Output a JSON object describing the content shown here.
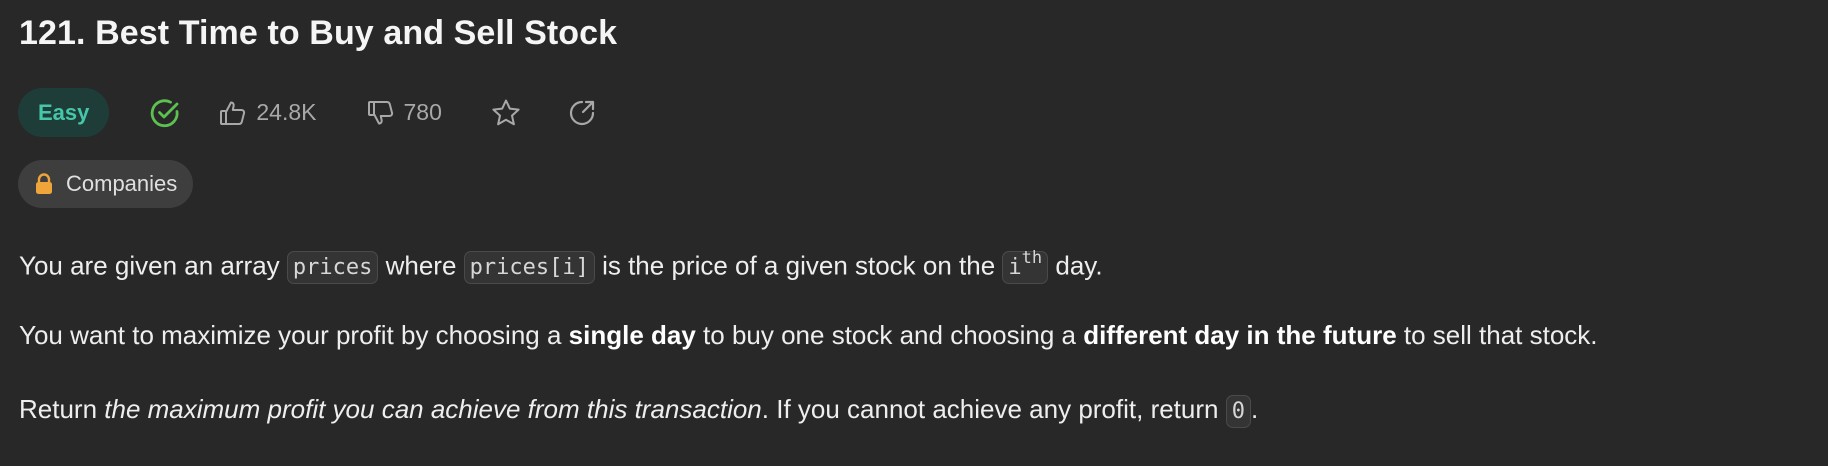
{
  "problem": {
    "title": "121. Best Time to Buy and Sell Stock",
    "difficulty": "Easy",
    "status_icon": "check-circle-icon",
    "likes": "24.8K",
    "dislikes": "780",
    "favorite_icon": "star-icon",
    "share_icon": "share-icon",
    "companies_label": "Companies",
    "companies_icon": "lock-icon"
  },
  "colors": {
    "easy_text": "#46c6a8",
    "easy_bg": "#1f3d38",
    "solved": "#5cc150",
    "lock": "#f0a53a",
    "background": "#282828"
  },
  "description": {
    "p1": {
      "t1": "You are given an array ",
      "c1": "prices",
      "t2": " where ",
      "c2": "prices[i]",
      "t3": " is the price of a given stock on the ",
      "c3_base": "i",
      "c3_sup": "th",
      "t4": " day."
    },
    "p2": {
      "t1": "You want to maximize your profit by choosing a ",
      "b1": "single day",
      "t2": " to buy one stock and choosing a ",
      "b2": "different day in the future",
      "t3": " to sell that stock."
    },
    "p3": {
      "t1": "Return ",
      "i1": "the maximum profit you can achieve from this transaction",
      "t2": ". If you cannot achieve any profit, return ",
      "c1": "0",
      "t3": "."
    }
  }
}
